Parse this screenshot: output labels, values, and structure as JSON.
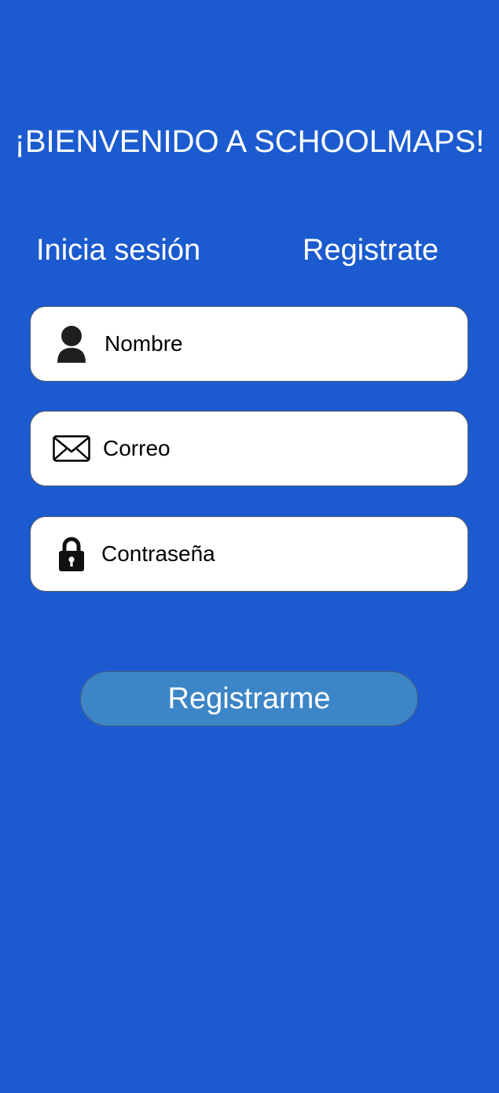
{
  "header": {
    "title": "¡BIENVENIDO A SCHOOLMAPS!"
  },
  "tabs": {
    "login_label": "Inicia sesión",
    "register_label": "Registrate"
  },
  "form": {
    "name_placeholder": "Nombre",
    "email_placeholder": "Correo",
    "password_placeholder": "Contraseña",
    "name_icon": "user-icon",
    "email_icon": "envelope-icon",
    "password_icon": "lock-icon"
  },
  "actions": {
    "submit_label": "Registrarme"
  },
  "colors": {
    "background": "#1b5bcf",
    "button": "#3c85c6",
    "field": "#ffffff",
    "text_light": "#ffffff"
  }
}
